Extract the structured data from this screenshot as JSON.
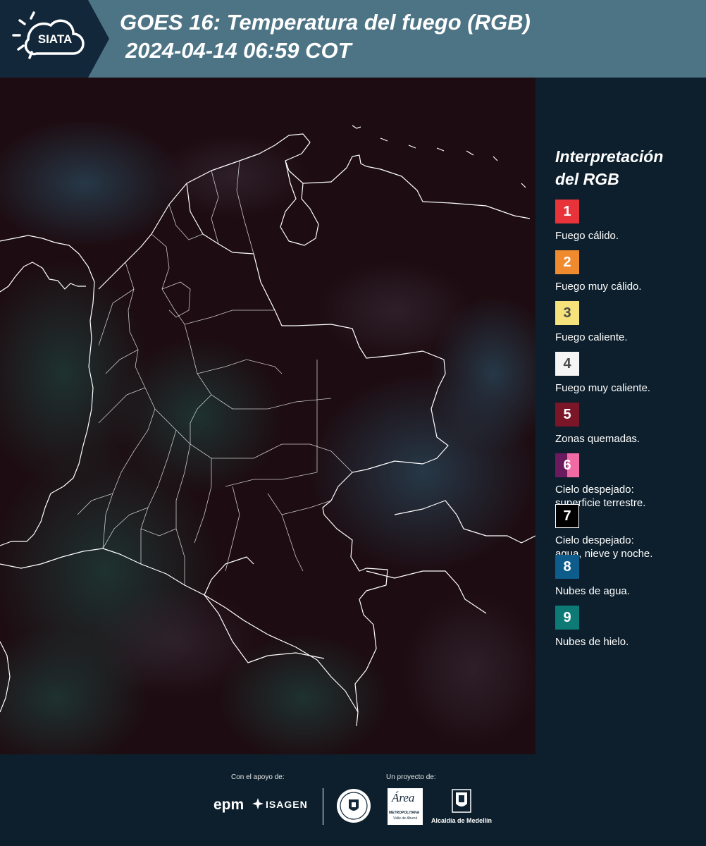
{
  "header": {
    "logo_text": "SIATA",
    "title_line1": "GOES 16: Temperatura del fuego (RGB)",
    "title_line2": "2024-04-14 06:59 COT"
  },
  "legend": {
    "title_line1": "Interpretación",
    "title_line2": "del RGB",
    "items": [
      {
        "number": "1",
        "color": "#e8333b",
        "text_color": "#ffffff",
        "label": "Fuego cálido.",
        "label2": ""
      },
      {
        "number": "2",
        "color": "#f08a2e",
        "text_color": "#ffffff",
        "label": "Fuego muy cálido.",
        "label2": ""
      },
      {
        "number": "3",
        "color": "#f6e27a",
        "text_color": "#4a4a4a",
        "label": "Fuego caliente.",
        "label2": ""
      },
      {
        "number": "4",
        "color": "#f5f5f5",
        "text_color": "#4a4a4a",
        "label": "Fuego muy caliente.",
        "label2": ""
      },
      {
        "number": "5",
        "color": "#7a1628",
        "text_color": "#ffffff",
        "label": "Zonas quemadas.",
        "label2": ""
      },
      {
        "number": "6",
        "color": "#6b1a5e",
        "color2": "#f06aa4",
        "text_color": "#ffffff",
        "label": "Cielo despejado:",
        "label2": "superficie terrestre."
      },
      {
        "number": "7",
        "color": "#000000",
        "text_color": "#ffffff",
        "label": "Cielo despejado:",
        "label2": "agua, nieve y noche."
      },
      {
        "number": "8",
        "color": "#0d5c8c",
        "text_color": "#ffffff",
        "label": "Nubes de agua.",
        "label2": ""
      },
      {
        "number": "9",
        "color": "#0e7a76",
        "text_color": "#ffffff",
        "label": "Nubes de hielo.",
        "label2": ""
      }
    ]
  },
  "footer": {
    "support_label": "Con el apoyo de:",
    "project_label": "Un proyecto de:",
    "epm": "epm",
    "isagen": "ISAGEN",
    "area_name": "Área",
    "area_sub": "METROPOLITANA",
    "area_sub2": "Valle de Aburrá",
    "alcaldia": "Alcaldía de Medellín"
  }
}
